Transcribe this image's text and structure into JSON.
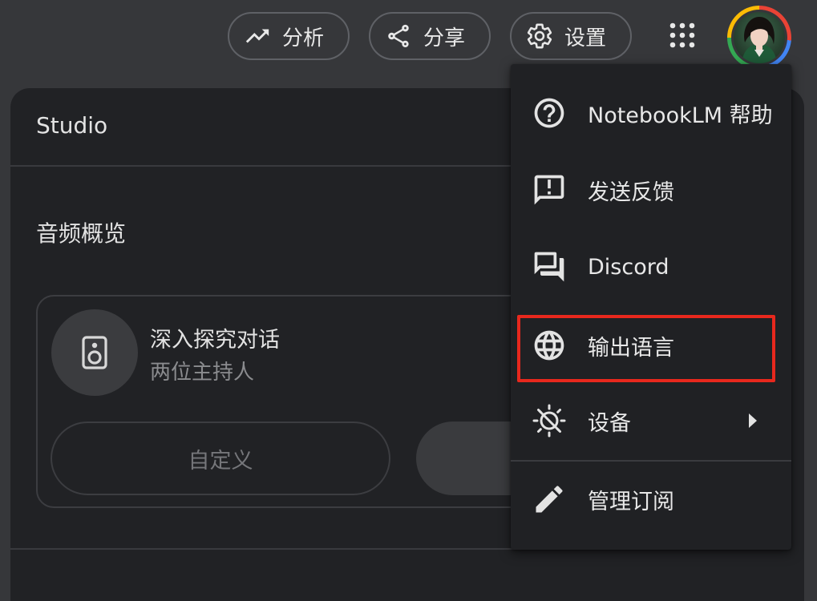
{
  "toolbar": {
    "analytics_label": "分析",
    "share_label": "分享",
    "settings_label": "设置"
  },
  "studio": {
    "title": "Studio",
    "section_title": "音频概览",
    "audio_card": {
      "title": "深入探究对话",
      "subtitle": "两位主持人",
      "customize_label": "自定义"
    }
  },
  "menu": {
    "items": [
      {
        "label": "NotebookLM 帮助",
        "icon": "help-circle-icon"
      },
      {
        "label": "发送反馈",
        "icon": "feedback-icon"
      },
      {
        "label": "Discord",
        "icon": "forum-icon"
      },
      {
        "label": "输出语言",
        "icon": "globe-icon"
      },
      {
        "label": "设备",
        "icon": "device-theme-icon"
      },
      {
        "label": "管理订阅",
        "icon": "pencil-icon"
      }
    ]
  },
  "colors": {
    "page_bg": "#36373a",
    "panel_bg": "#212225",
    "menu_bg": "#202124",
    "highlight": "#e8281d",
    "text": "#e3e3e3",
    "muted_text": "#8b8c8f"
  }
}
